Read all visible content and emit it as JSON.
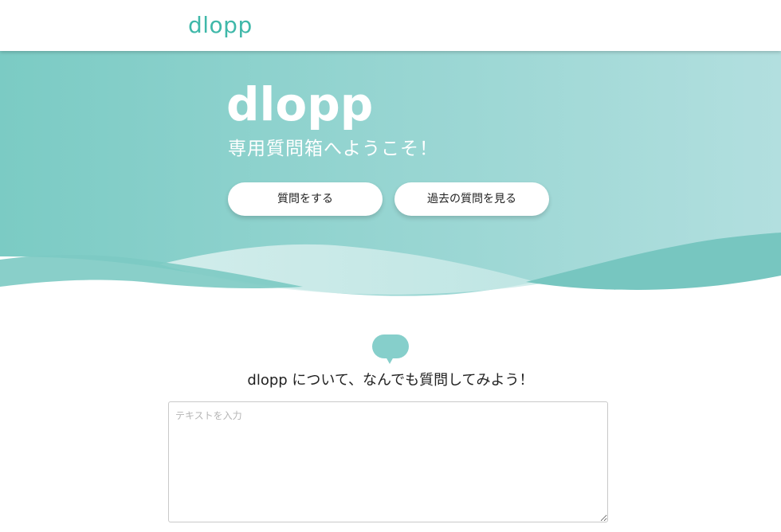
{
  "header": {
    "logo": "dlopp"
  },
  "hero": {
    "logo": "dlopp",
    "tagline": "専用質問箱へようこそ！",
    "ask_button": "質問をする",
    "past_button": "過去の質問を見る"
  },
  "main": {
    "icon": "speech-bubble-icon",
    "prompt": "dlopp について、なんでも質問してみよう！",
    "input_placeholder": "テキストを入力",
    "input_value": ""
  },
  "colors": {
    "brand": "#3fb8a9",
    "hero_start": "#7bcbc4",
    "hero_end": "#b2dfdf",
    "bubble": "#86cfcb"
  }
}
